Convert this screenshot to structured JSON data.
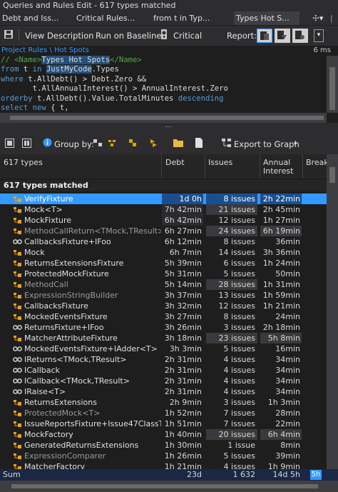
{
  "window": {
    "title": "Queries and Rules Edit  - 617 types matched"
  },
  "tabs": [
    {
      "label": "Debt and Iss..."
    },
    {
      "label": "Critical Rules..."
    },
    {
      "label": "from t in Typ..."
    },
    {
      "label": "Types Hot S..."
    }
  ],
  "toolbar": {
    "view_description": "View Description",
    "run_on_baseline": "Run on Baseline",
    "critical": "Critical",
    "report": "Report:"
  },
  "breadcrumb": {
    "path": "Project Rules \\ Hot Spots",
    "time": "6 ms"
  },
  "code": {
    "line1_comment": "// <Name>",
    "line1_name": "Types Hot Spots",
    "line1_end": "</Name>",
    "line2_kw": "from",
    "line2_a": " t ",
    "line2_in": "in",
    "line2_space": " ",
    "line2_hl": "JustMyCode",
    "line2_b": ".Types",
    "line3_kw": "where",
    "line3_rest": " t.AllDebt() > Debt.Zero &&",
    "line4": "       t.AllAnnualInterest() > AnnualInterest.Zero",
    "line5_kw": "orderby",
    "line5_rest": " t.AllDebt().Value.TotalMinutes ",
    "line5_desc": "descending",
    "line6_kw": "select new",
    "line6_rest": " { t,"
  },
  "results_toolbar": {
    "group_by": "Group by:",
    "export": "Export to Graph"
  },
  "columns": {
    "name": "617 types",
    "debt": "Debt",
    "issues": "Issues",
    "interest_line1": "Annual",
    "interest_line2": "Interest",
    "breaking": "Break"
  },
  "group": {
    "label": "617 types matched"
  },
  "rows": [
    {
      "name": "VerifyFixture",
      "debt": "1d  0h",
      "issues": "8 issues",
      "interest": "2h  22min"
    },
    {
      "name": "Mock<T>",
      "debt": "7h  42min",
      "issues": "21 issues",
      "interest": "2h  45min"
    },
    {
      "name": "MockFixture",
      "debt": "6h  42min",
      "issues": "12 issues",
      "interest": "1h  27min"
    },
    {
      "name": "MethodCallReturn<TMock,TResult>",
      "debt": "6h  27min",
      "issues": "24 issues",
      "interest": "6h  19min"
    },
    {
      "name": "CallbacksFixture+IFoo",
      "debt": "6h  12min",
      "issues": "8 issues",
      "interest": "36min"
    },
    {
      "name": "Mock",
      "debt": "6h  7min",
      "issues": "14 issues",
      "interest": "3h  36min"
    },
    {
      "name": "ReturnsExtensionsFixture",
      "debt": "5h  39min",
      "issues": "6 issues",
      "interest": "1h  24min"
    },
    {
      "name": "ProtectedMockFixture",
      "debt": "5h  31min",
      "issues": "5 issues",
      "interest": "50min"
    },
    {
      "name": "MethodCall",
      "debt": "5h  14min",
      "issues": "28 issues",
      "interest": "1h  31min"
    },
    {
      "name": "ExpressionStringBuilder",
      "debt": "3h  37min",
      "issues": "13 issues",
      "interest": "1h  59min"
    },
    {
      "name": "CallbacksFixture",
      "debt": "3h  32min",
      "issues": "12 issues",
      "interest": "1h  21min"
    },
    {
      "name": "MockedEventsFixture",
      "debt": "3h  27min",
      "issues": "8 issues",
      "interest": "24min"
    },
    {
      "name": "ReturnsFixture+IFoo",
      "debt": "3h  26min",
      "issues": "3 issues",
      "interest": "2h  18min"
    },
    {
      "name": "MatcherAttributeFixture",
      "debt": "3h  18min",
      "issues": "23 issues",
      "interest": "5h  8min"
    },
    {
      "name": "MockedEventsFixture+IAdder<T>",
      "debt": "3h  3min",
      "issues": "5 issues",
      "interest": "16min"
    },
    {
      "name": "IReturns<TMock,TResult>",
      "debt": "2h  31min",
      "issues": "4 issues",
      "interest": "34min"
    },
    {
      "name": "ICallback",
      "debt": "2h  31min",
      "issues": "4 issues",
      "interest": "34min"
    },
    {
      "name": "ICallback<TMock,TResult>",
      "debt": "2h  31min",
      "issues": "4 issues",
      "interest": "34min"
    },
    {
      "name": "IRaise<T>",
      "debt": "2h  31min",
      "issues": "4 issues",
      "interest": "34min"
    },
    {
      "name": "ReturnsExtensions",
      "debt": "2h  9min",
      "issues": "3 issues",
      "interest": "1h  3min"
    },
    {
      "name": "ProtectedMock<T>",
      "debt": "1h  52min",
      "issues": "7 issues",
      "interest": "28min"
    },
    {
      "name": "IssueReportsFixture+Issue47ClassToMo",
      "debt": "1h  51min",
      "issues": "7 issues",
      "interest": "22min"
    },
    {
      "name": "MockFactory",
      "debt": "1h  40min",
      "issues": "20 issues",
      "interest": "6h  4min"
    },
    {
      "name": "GeneratedReturnsExtensions",
      "debt": "1h  30min",
      "issues": "1 issue",
      "interest": "8min"
    },
    {
      "name": "ExpressionComparer",
      "debt": "1h  26min",
      "issues": "5 issues",
      "interest": "39min"
    },
    {
      "name": "MatcherFactory",
      "debt": "1h  21min",
      "issues": "4 issues",
      "interest": "1h  9min"
    }
  ],
  "sum": {
    "label": "Sum",
    "debt": "23d",
    "issues": "1 632",
    "interest": "14d  5h"
  }
}
